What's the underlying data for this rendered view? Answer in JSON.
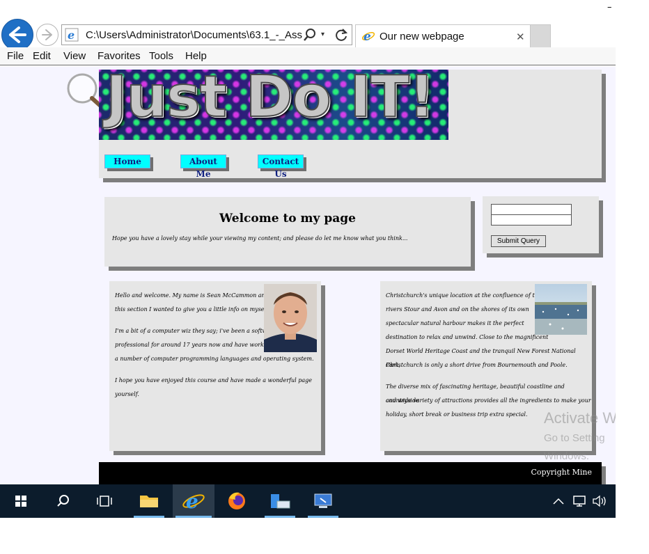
{
  "browser": {
    "address": "C:\\Users\\Administrator\\Documents\\63.1_-_Ass",
    "tab_title": "Our new webpage",
    "tab_close": "✕",
    "minimize": "–",
    "dropdown_arrow": "▾"
  },
  "menu": [
    "File",
    "Edit",
    "View",
    "Favorites",
    "Tools",
    "Help"
  ],
  "page": {
    "banner": "Just Do IT!",
    "nav": [
      "Home",
      "About Me",
      "Contact Us"
    ],
    "welcome_title": "Welcome to my page",
    "welcome_text": "Hope you have a lovely stay while your viewing my content; and please do let me know what you think...",
    "submit_label": "Submit Query",
    "about_paragraphs": [
      [
        "Hello and welcome. My name is Sean McCammon and in",
        "this section I wanted to give you a little info on myself."
      ],
      [
        "I'm a bit of a computer wiz they say; i've been a software",
        "professional for around 17 years now and have worked in",
        "a number of computer programming languages and operating system."
      ],
      [
        "I hope you have enjoyed this course and have made a wonderful page yourself."
      ]
    ],
    "city_paragraphs": [
      [
        "Christchurch's unique location at the confluence of the",
        "rivers Stour and Avon and on the shores of its own",
        "spectacular natural harbour makes it the perfect",
        "destination to relax and unwind. Close to the magnificent",
        "Dorset World Heritage Coast and the tranquil New Forest National Park,",
        "Christchurch is only a short drive from Bournemouth and Poole."
      ],
      [
        "The diverse mix of fascinating heritage, beautiful coastline and countryside",
        "and wide variety of attractions provides all the ingredients to make your",
        "holiday, short break or business trip extra special."
      ]
    ],
    "footer": "Copyright Mine"
  },
  "watermark": [
    "Activate W",
    "Go to Setting",
    "Windows."
  ],
  "icons": {
    "back": "back-arrow-icon",
    "forward": "forward-arrow-icon",
    "search": "search-icon",
    "refresh": "refresh-icon"
  },
  "colors": {
    "nav_button": "#00ffff",
    "panel": "#e6e6e6",
    "taskbar": "#0c1c2c",
    "back_button": "#1f6fc5"
  }
}
